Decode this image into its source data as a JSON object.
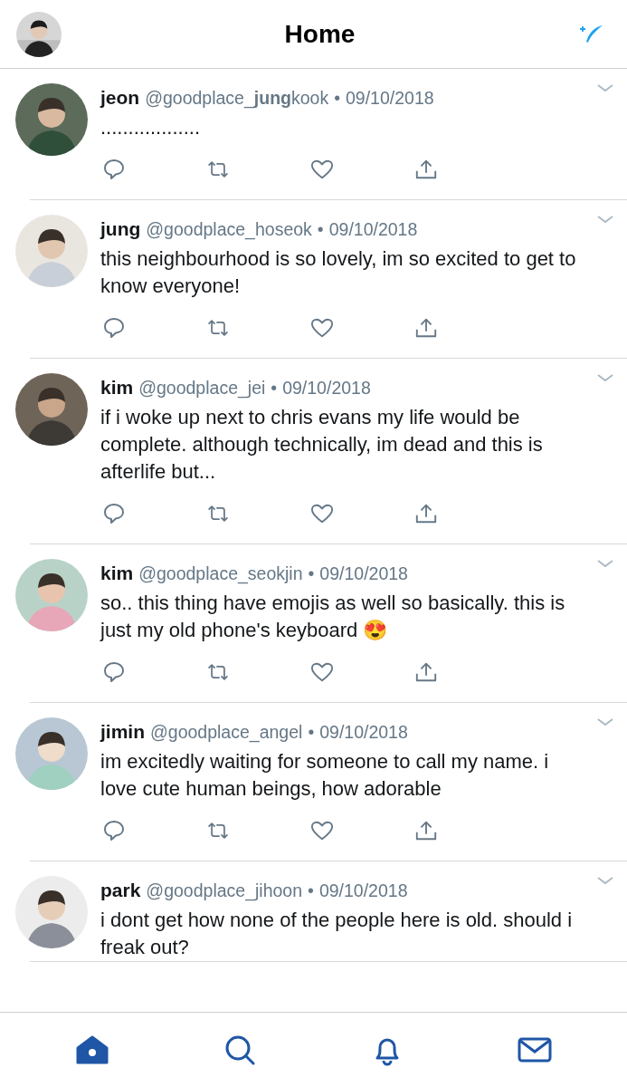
{
  "header": {
    "title": "Home"
  },
  "tweets": [
    {
      "name": "jeon",
      "handle": "@goodplace_**jung**kook",
      "dot": "•",
      "date": "09/10/2018",
      "text": "..................",
      "actions_shown": true
    },
    {
      "name": "jung",
      "handle": "@goodplace_hoseok",
      "dot": "•",
      "date": "09/10/2018",
      "text": "this neighbourhood is so lovely, im so excited to get to know everyone!",
      "actions_shown": true
    },
    {
      "name": "kim",
      "handle": "@goodplace_jei",
      "dot": "•",
      "date": "09/10/2018",
      "text": "if i woke up next to chris evans my life would be complete. although technically, im dead and this is afterlife but...",
      "actions_shown": true
    },
    {
      "name": "kim",
      "handle": "@goodplace_seokjin",
      "dot": "•",
      "date": "09/10/2018",
      "text": "so.. this thing have emojis as well so basically. this is just my old phone's keyboard 😍",
      "actions_shown": true
    },
    {
      "name": "jimin",
      "handle": "@goodplace_angel",
      "dot": "•",
      "date": "09/10/2018",
      "text": "im excitedly waiting for someone to call my name. i love cute human beings, how adorable",
      "actions_shown": true
    },
    {
      "name": "park",
      "handle": "@goodplace_jihoon",
      "dot": "•",
      "date": "09/10/2018",
      "text": "i dont get how none of the people here is old. should i freak out?",
      "actions_shown": false
    }
  ],
  "tab_bar": [
    {
      "kind": "home",
      "selected": true
    },
    {
      "kind": "search",
      "selected": false
    },
    {
      "kind": "notifications",
      "selected": false
    },
    {
      "kind": "messages",
      "selected": false
    }
  ]
}
